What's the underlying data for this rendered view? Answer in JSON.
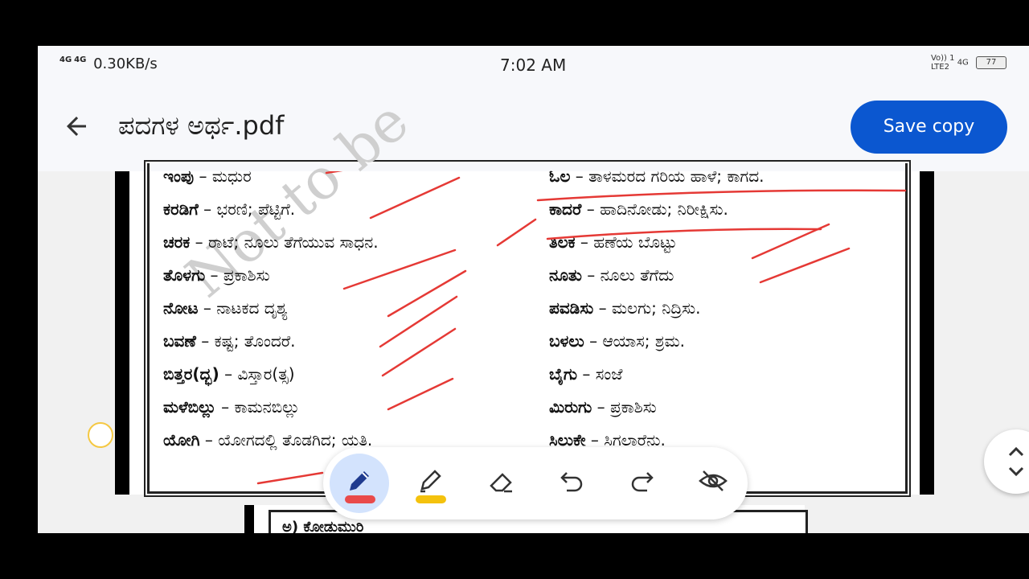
{
  "status_bar": {
    "network_1": "4G",
    "network_2": "4G",
    "speed": "0.30KB/s",
    "time": "7:02 AM",
    "volte": "Vo)) 1",
    "lte": "LTE2",
    "net_type": "4G",
    "battery": "77"
  },
  "app_bar": {
    "title": "ಪದಗಳ ಅರ್ಥ.pdf",
    "save_label": "Save copy",
    "back_icon": "arrow-left-icon"
  },
  "document": {
    "watermark": "Not to be",
    "left_column": [
      {
        "term": "ಇಂಪು",
        "meaning": "ಮಧುರ"
      },
      {
        "term": "ಕರಡಿಗೆ",
        "meaning": "ಭರಣಿ; ಪೆಟ್ಟಿಗೆ."
      },
      {
        "term": "ಚರಕ",
        "meaning": "ರಾಟೆ; ನೂಲು ತೆಗೆಯುವ ಸಾಧನ."
      },
      {
        "term": "ತೊಳಗು",
        "meaning": "ಪ್ರಕಾಶಿಸು"
      },
      {
        "term": "ನೋಟ",
        "meaning": "ನಾಟಕದ ದೃಶ್ಯ"
      },
      {
        "term": "ಬವಣೆ",
        "meaning": "ಕಷ್ಟ; ತೊಂದರೆ."
      },
      {
        "term": "ಬಿತ್ತರ(ದ್ಭ)",
        "meaning": "ವಿಸ್ತಾರ(ತ್ಸ)"
      },
      {
        "term": "ಮಳೆಬಿಲ್ಲು",
        "meaning": "ಕಾಮನಬಿಲ್ಲು"
      },
      {
        "term": "ಯೋಗಿ",
        "meaning": "ಯೋಗದಲ್ಲಿ ತೊಡಗಿದ; ಯತಿ."
      }
    ],
    "right_column": [
      {
        "term": "ಓಲ",
        "meaning": "ತಾಳಮರದ ಗರಿಯ ಹಾಳೆ; ಕಾಗದ."
      },
      {
        "term": "ಕಾದರೆ",
        "meaning": "ಹಾದಿನೋಡು; ನಿರೀಕ್ಷಿಸು."
      },
      {
        "term": "ತಿಲಕ",
        "meaning": "ಹಣೆಯ ಬೊಟ್ಟು"
      },
      {
        "term": "ನೂತು",
        "meaning": "ನೂಲು ತೆಗೆದು"
      },
      {
        "term": "ಪವಡಿಸು",
        "meaning": "ಮಲಗು; ನಿದ್ರಿಸು."
      },
      {
        "term": "ಬಳಲು",
        "meaning": "ಆಯಾಸ; ಶ್ರಮ."
      },
      {
        "term": "ಬೈಗು",
        "meaning": "ಸಂಜೆ"
      },
      {
        "term": "ಮಿರುಗು",
        "meaning": "ಪ್ರಕಾಶಿಸು"
      },
      {
        "term": "ಸಿಲುಕೇ",
        "meaning": "ಸಿಗಲಾರೆನು."
      }
    ],
    "separator": " – ",
    "next_page_text": "ಅ) ಕೋಡುಮುರಿ"
  },
  "toolbar": {
    "tools": [
      "pen-icon",
      "highlighter-icon",
      "eraser-icon",
      "undo-icon",
      "redo-icon",
      "hide-annotations-icon"
    ],
    "pen_color": "#e94a4a",
    "highlighter_color": "#f4c20d",
    "ink_color": "#e53935"
  },
  "colors": {
    "accent": "#0b57d0",
    "active_tool_bg": "#d3e3fd"
  }
}
